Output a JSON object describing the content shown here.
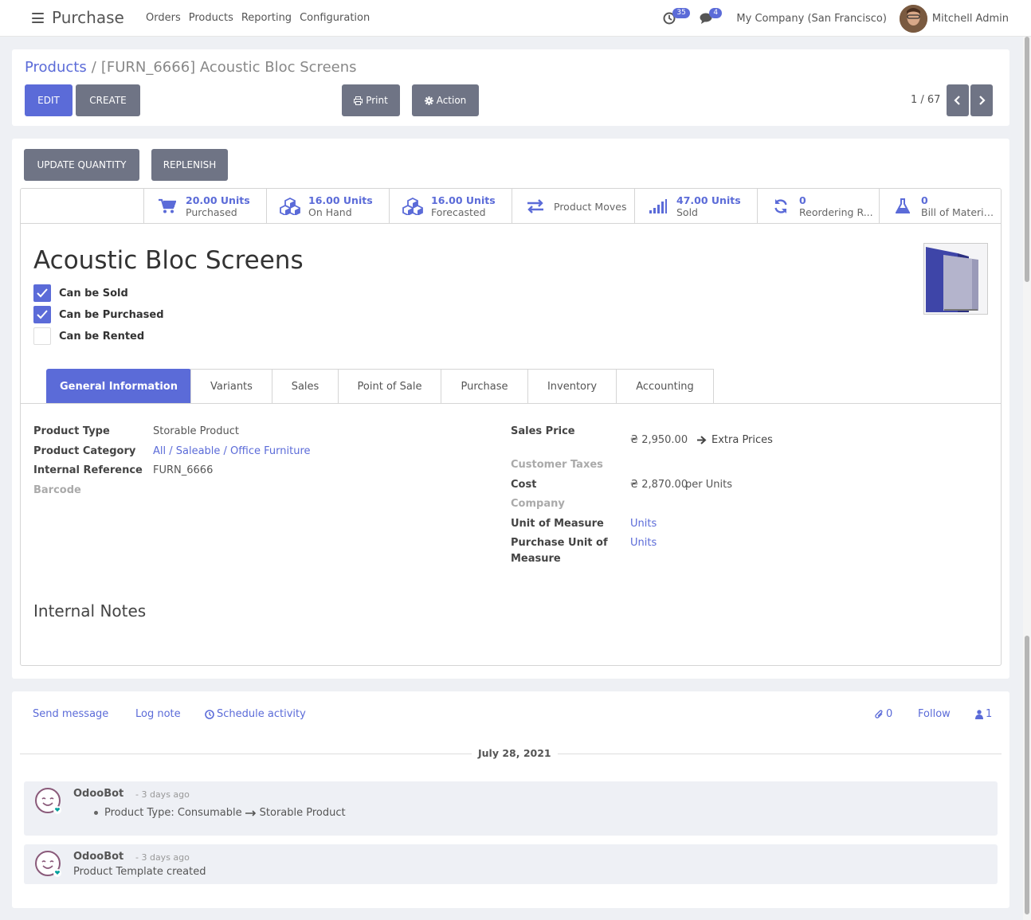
{
  "navbar": {
    "app_name": "Purchase",
    "menu": [
      "Orders",
      "Products",
      "Reporting",
      "Configuration"
    ],
    "activity_count": "35",
    "message_count": "4",
    "company": "My Company (San Francisco)",
    "user": "Mitchell Admin"
  },
  "breadcrumb": {
    "parent": "Products",
    "separator": "/",
    "current": "[FURN_6666] Acoustic Bloc Screens"
  },
  "toolbar": {
    "edit": "EDIT",
    "create": "CREATE",
    "print": "Print",
    "action": "Action",
    "pager": "1 / 67"
  },
  "header_buttons": {
    "update_quantity": "UPDATE QUANTITY",
    "replenish": "REPLENISH"
  },
  "stat_buttons": [
    {
      "value": "20.00 Units",
      "label": "Purchased",
      "icon": "cart-icon"
    },
    {
      "value": "16.00 Units",
      "label": "On Hand",
      "icon": "cubes-icon"
    },
    {
      "value": "16.00 Units",
      "label": "Forecasted",
      "icon": "cubes-icon"
    },
    {
      "value": "",
      "label": "Product Moves",
      "icon": "exchange-icon"
    },
    {
      "value": "47.00 Units",
      "label": "Sold",
      "icon": "signal-icon"
    },
    {
      "value": "0",
      "label": "Reordering R...",
      "icon": "refresh-icon"
    },
    {
      "value": "0",
      "label": "Bill of Materia...",
      "icon": "flask-icon"
    }
  ],
  "product": {
    "name": "Acoustic Bloc Screens",
    "can_be_sold": "Can be Sold",
    "can_be_purchased": "Can be Purchased",
    "can_be_rented": "Can be Rented"
  },
  "tabs": [
    "General Information",
    "Variants",
    "Sales",
    "Point of Sale",
    "Purchase",
    "Inventory",
    "Accounting"
  ],
  "general": {
    "product_type_label": "Product Type",
    "product_type": "Storable Product",
    "product_category_label": "Product Category",
    "product_category": "All / Saleable / Office Furniture",
    "internal_reference_label": "Internal Reference",
    "internal_reference": "FURN_6666",
    "barcode_label": "Barcode",
    "sales_price_label": "Sales Price",
    "sales_price": "₴ 2,950.00",
    "extra_prices": "Extra Prices",
    "customer_taxes_label": "Customer Taxes",
    "cost_label": "Cost",
    "cost": "₴ 2,870.00",
    "cost_unit": "per Units",
    "company_label": "Company",
    "uom_label": "Unit of Measure",
    "uom": "Units",
    "purchase_uom_label_1": "Purchase Unit of",
    "purchase_uom_label_2": "Measure",
    "purchase_uom": "Units",
    "internal_notes": "Internal Notes"
  },
  "chatter": {
    "send_message": "Send message",
    "log_note": "Log note",
    "schedule_activity": "Schedule activity",
    "attachments": "0",
    "follow": "Follow",
    "followers": "1",
    "date": "July 28, 2021",
    "messages": [
      {
        "author": "OdooBot",
        "time": "- 3 days ago",
        "body_prefix": "Product Type: Consumable",
        "body_suffix": "Storable Product"
      },
      {
        "author": "OdooBot",
        "time": "- 3 days ago",
        "body": "Product Template created"
      }
    ]
  },
  "colors": {
    "primary": "#5b6bd8",
    "secondary": "#6f7485"
  }
}
